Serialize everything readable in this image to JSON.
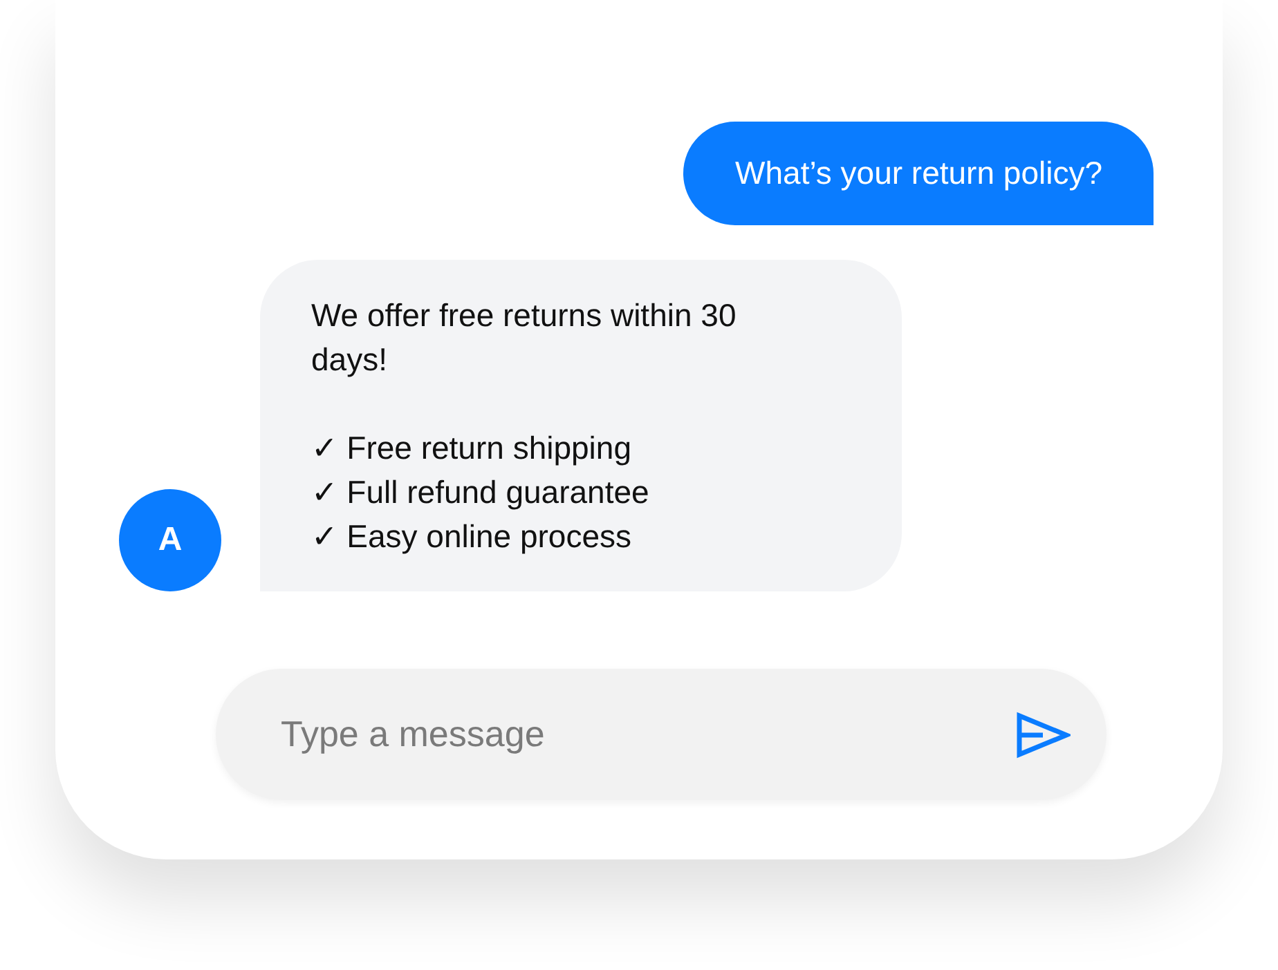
{
  "messages": [
    {
      "kind": "user",
      "text": "What’s your return policy?"
    },
    {
      "kind": "bot",
      "avatar": "A",
      "text": "We offer free returns within 30 days!",
      "items": [
        "✓ Free return shipping",
        "✓ Full refund guarantee",
        "✓ Easy online process"
      ]
    }
  ],
  "composer": {
    "placeholder": "Type a message"
  }
}
